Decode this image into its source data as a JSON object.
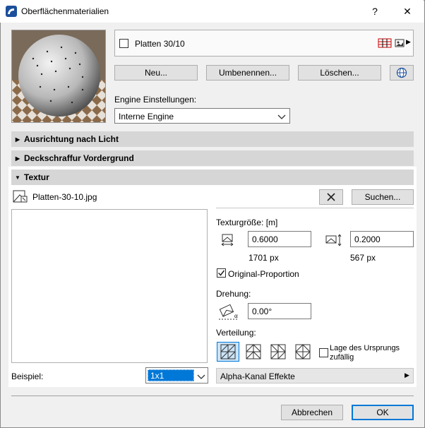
{
  "window": {
    "title": "Oberflächenmaterialien",
    "help_label": "?",
    "close_label": "✕"
  },
  "material": {
    "name": "Platten 30/10"
  },
  "buttons": {
    "new": "Neu...",
    "rename": "Umbenennen...",
    "delete": "Löschen...",
    "search": "Suchen...",
    "cancel": "Abbrechen",
    "ok": "OK"
  },
  "engine": {
    "label": "Engine Einstellungen:",
    "selected": "Interne Engine"
  },
  "sections": {
    "light": "Ausrichtung nach Licht",
    "hatch": "Deckschraffur Vordergrund",
    "texture": "Textur"
  },
  "texture": {
    "file": "Platten-30-10.jpg",
    "size_label": "Texturgröße: [m]",
    "width": "0.6000",
    "height": "0.2000",
    "width_px": "1701 px",
    "height_px": "567 px",
    "proportion_label": "Original-Proportion",
    "proportion_checked": true,
    "rotation_label": "Drehung:",
    "rotation": "0.00°",
    "distribution_label": "Verteilung:",
    "origin_label_1": "Lage des Ursprungs",
    "origin_label_2": "zufällig",
    "example_label": "Beispiel:",
    "example_value": "1x1",
    "alpha_label": "Alpha-Kanal Effekte"
  },
  "icons": {
    "app": "archicad-icon",
    "hatch": "hatch-grid-icon",
    "preview": "image-preview-icon",
    "globe": "globe-icon",
    "file": "texture-file-icon",
    "remove": "close-x-icon",
    "width": "texture-width-icon",
    "height": "texture-height-icon",
    "rotation": "rotation-angle-icon"
  },
  "colors": {
    "accent": "#0078d7",
    "selection": "#0078d7",
    "section_bg": "#d6d6d6"
  }
}
